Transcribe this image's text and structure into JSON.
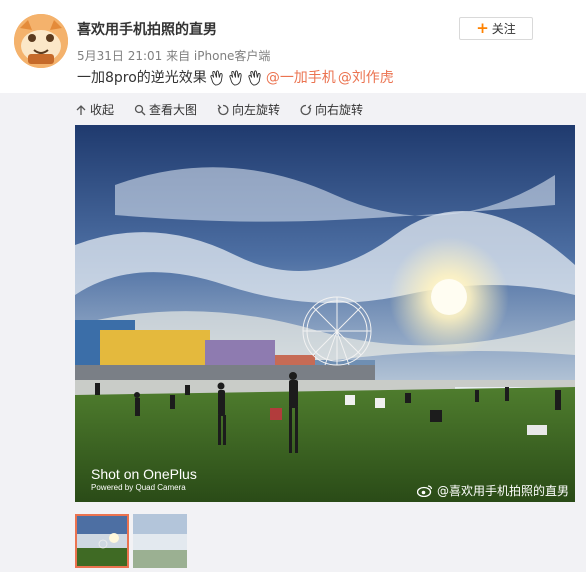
{
  "post": {
    "author": "喜欢用手机拍照的直男",
    "meta": "5月31日 21:01 来自 iPhone客户端",
    "follow_label": "关注",
    "text_prefix": "一加8pro的逆光效果",
    "emoji_name": "clap-icon",
    "mention_1": "@一加手机",
    "mention_2": "@刘作虎"
  },
  "toolbar": {
    "collapse": "收起",
    "view_large": "查看大图",
    "rotate_left": "向左旋转",
    "rotate_right": "向右旋转"
  },
  "photo": {
    "shot_on": "Shot on OnePlus",
    "powered_by": "Powered by Quad Camera",
    "watermark": "@喜欢用手机拍照的直男"
  },
  "colors": {
    "accent": "#eb7350",
    "follow_plus": "#ff8200",
    "media_bg": "#f2f2f5"
  }
}
